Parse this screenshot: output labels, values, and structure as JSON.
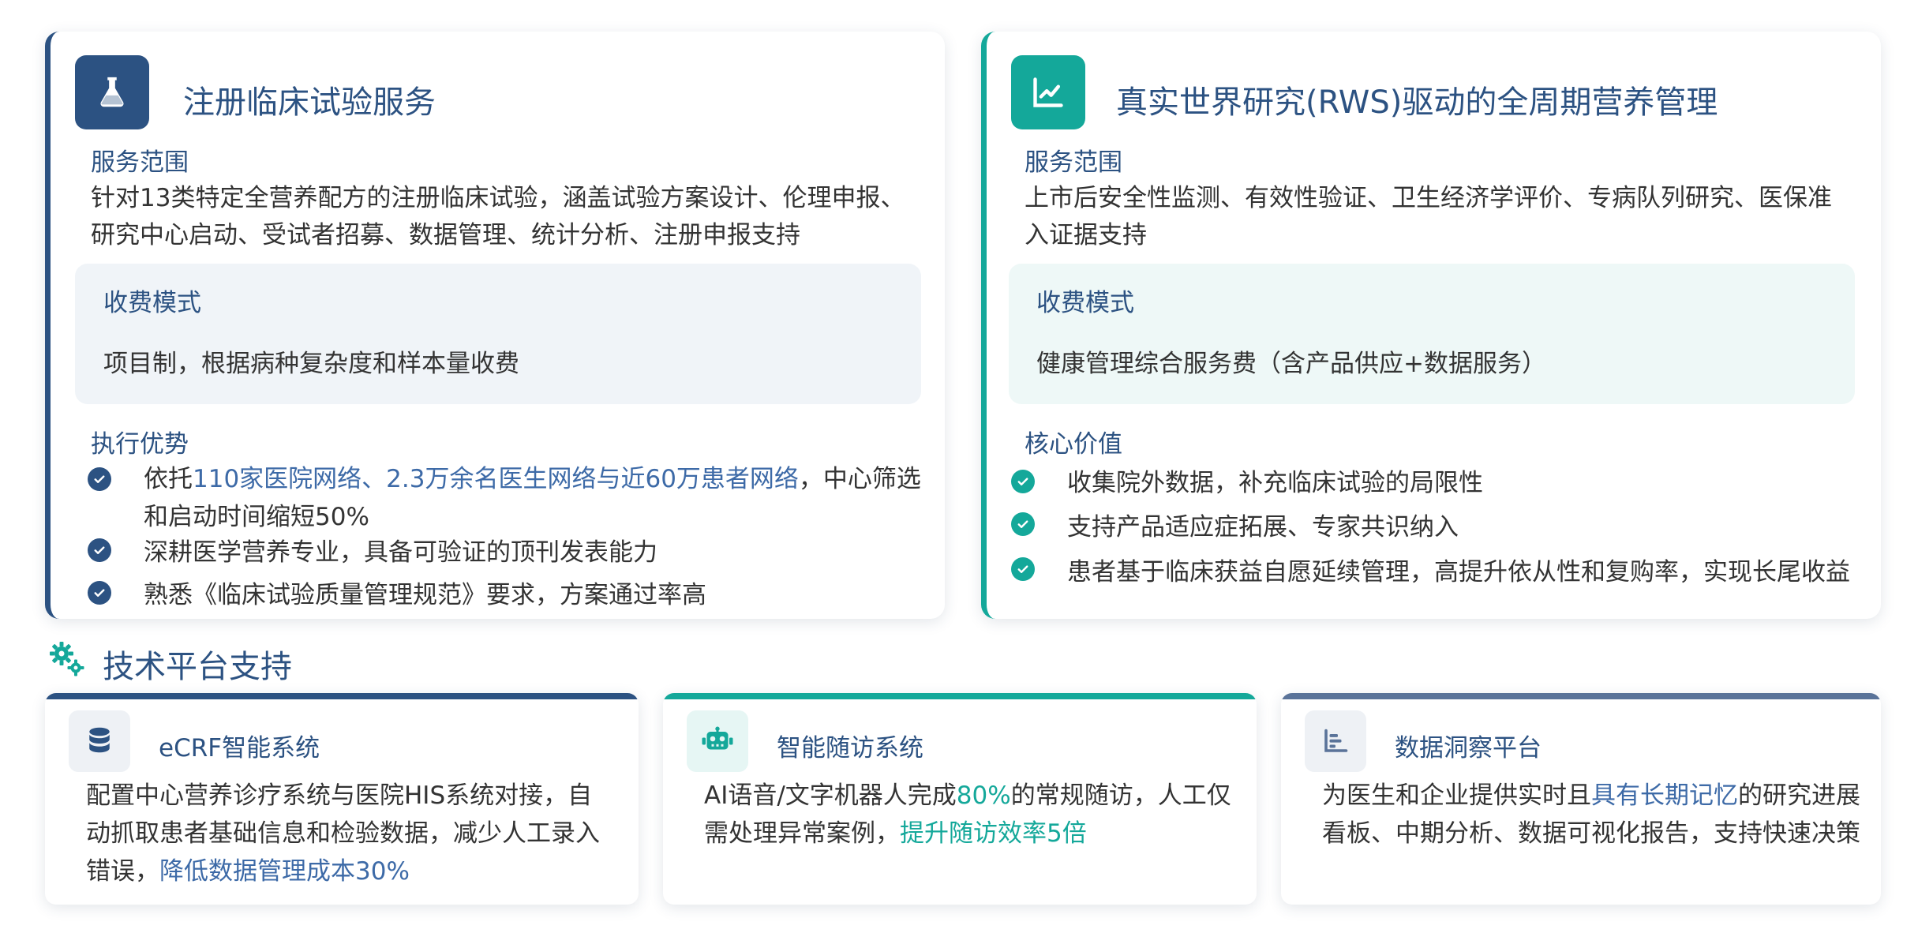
{
  "cards": {
    "clinical": {
      "icon": "flask-icon",
      "title": "注册临床试验服务",
      "scope_label": "服务范围",
      "scope_line1": "针对13类特定全营养配方的注册临床试验，涵盖试验方案设计、伦理申报、",
      "scope_line2": "研究中心启动、受试者招募、数据管理、统计分析、注册申报支持",
      "fee_label": "收费模式",
      "fee_text": "项目制，根据病种复杂度和样本量收费",
      "adv_label": "执行优势",
      "adv_items": [
        {
          "prefix": "依托",
          "highlight": "110家医院网络、2.3万余名医生网络与近60万患者网络",
          "suffix": "，中心筛选",
          "line2": "和启动时间缩短50%"
        },
        {
          "text": "深耕医学营养专业，具备可验证的顶刊发表能力"
        },
        {
          "text": "熟悉《临床试验质量管理规范》要求，方案通过率高"
        }
      ]
    },
    "rws": {
      "icon": "line-chart-icon",
      "title": "真实世界研究(RWS)驱动的全周期营养管理",
      "scope_label": "服务范围",
      "scope_line1": "上市后安全性监测、有效性验证、卫生经济学评价、专病队列研究、医保准",
      "scope_line2": "入证据支持",
      "fee_label": "收费模式",
      "fee_text": "健康管理综合服务费（含产品供应+数据服务）",
      "value_label": "核心价值",
      "value_items": [
        "收集院外数据，补充临床试验的局限性",
        "支持产品适应症拓展、专家共识纳入",
        "患者基于临床获益自愿延续管理，高提升依从性和复购率，实现长尾收益"
      ]
    }
  },
  "platform": {
    "icon": "gears-icon",
    "title": "技术平台支持",
    "items": [
      {
        "icon": "database-icon",
        "title": "eCRF智能系统",
        "text_before": "配置中心营养诊疗系统与医院HIS系统对接，自动抓取患者基础信息和检验数据，减少人工录入错误，",
        "highlight": "降低数据管理成本30%",
        "text_after": ""
      },
      {
        "icon": "robot-icon",
        "title": "智能随访系统",
        "text_before": "AI语音/文字机器人完成",
        "highlight": "80%",
        "text_mid": "的常规随访，人工仅需处理异常案例，",
        "highlight2": "提升随访效率5倍"
      },
      {
        "icon": "bar-chart-icon",
        "title": "数据洞察平台",
        "text_before": "为医生和企业提供实时且",
        "highlight": "具有长期记忆",
        "text_after": "的研究进展看板、中期分析、数据可视化报告，支持快速决策"
      }
    ]
  },
  "colors": {
    "primary_blue": "#2c5282",
    "teal": "#14a89a",
    "slate": "#5a7399",
    "text": "#333333"
  }
}
